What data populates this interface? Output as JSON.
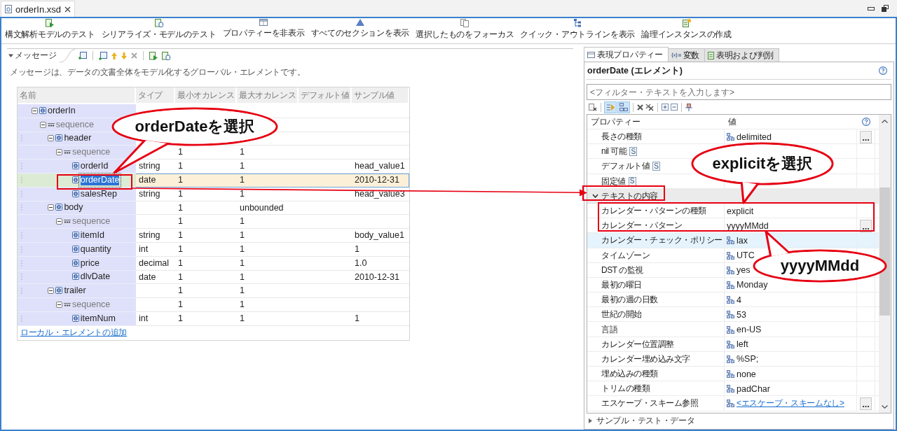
{
  "editor_tab": {
    "title": "orderIn.xsd"
  },
  "toolbar": [
    "構文解析モデルのテスト",
    "シリアライズ・モデルのテスト",
    "プロパティーを非表示",
    "すべてのセクションを表示",
    "選択したものをフォーカス",
    "クイック・アウトラインを表示",
    "論理インスタンスの作成"
  ],
  "message_section": {
    "title": "メッセージ",
    "expanded": true,
    "description": "メッセージは、データの文書全体をモデル化するグローバル・エレメントです。",
    "table": {
      "columns": [
        "名前",
        "タイプ",
        "最小オカレンス",
        "最大オカレンス",
        "デフォルト値",
        "サンプル値"
      ],
      "rows": [
        {
          "kind": "element",
          "name": "orderIn",
          "expanded": true,
          "selected": false,
          "children": [
            {
              "kind": "sequence",
              "name": "sequence",
              "expanded": true,
              "selected": false,
              "children": [
                {
                  "kind": "element",
                  "name": "header",
                  "expanded": true,
                  "grip": true,
                  "selected": false,
                  "children": [
                    {
                      "kind": "sequence",
                      "name": "sequence",
                      "min_occurs": "1",
                      "max_occurs": "1",
                      "expanded": true,
                      "selected": false,
                      "children": [
                        {
                          "kind": "element",
                          "name": "orderId",
                          "type": "string",
                          "min_occurs": "1",
                          "max_occurs": "1",
                          "sample": "head_value1",
                          "grip": true,
                          "selected": false
                        },
                        {
                          "kind": "element",
                          "name": "orderDate",
                          "type": "date",
                          "min_occurs": "1",
                          "max_occurs": "1",
                          "sample": "2010-12-31",
                          "grip": true,
                          "selected": true
                        },
                        {
                          "kind": "element",
                          "name": "salesRep",
                          "type": "string",
                          "min_occurs": "1",
                          "max_occurs": "1",
                          "sample": "head_value3",
                          "grip": true,
                          "selected": false
                        }
                      ]
                    }
                  ]
                },
                {
                  "kind": "element",
                  "name": "body",
                  "min_occurs": "1",
                  "max_occurs": "unbounded",
                  "expanded": true,
                  "grip": true,
                  "selected": false,
                  "children": [
                    {
                      "kind": "sequence",
                      "name": "sequence",
                      "min_occurs": "1",
                      "max_occurs": "1",
                      "expanded": true,
                      "selected": false,
                      "children": [
                        {
                          "kind": "element",
                          "name": "itemId",
                          "type": "string",
                          "min_occurs": "1",
                          "max_occurs": "1",
                          "sample": "body_value1",
                          "grip": true,
                          "selected": false
                        },
                        {
                          "kind": "element",
                          "name": "quantity",
                          "type": "int",
                          "min_occurs": "1",
                          "max_occurs": "1",
                          "sample": "1",
                          "grip": true,
                          "selected": false
                        },
                        {
                          "kind": "element",
                          "name": "price",
                          "type": "decimal",
                          "min_occurs": "1",
                          "max_occurs": "1",
                          "sample": "1.0",
                          "grip": true,
                          "selected": false
                        },
                        {
                          "kind": "element",
                          "name": "dlvDate",
                          "type": "date",
                          "min_occurs": "1",
                          "max_occurs": "1",
                          "sample": "2010-12-31",
                          "grip": true,
                          "selected": false
                        }
                      ]
                    }
                  ]
                },
                {
                  "kind": "element",
                  "name": "trailer",
                  "min_occurs": "1",
                  "max_occurs": "1",
                  "expanded": true,
                  "grip": true,
                  "selected": false,
                  "children": [
                    {
                      "kind": "sequence",
                      "name": "sequence",
                      "min_occurs": "1",
                      "max_occurs": "1",
                      "expanded": true,
                      "selected": false,
                      "children": [
                        {
                          "kind": "element",
                          "name": "itemNum",
                          "type": "int",
                          "min_occurs": "1",
                          "max_occurs": "1",
                          "sample": "1",
                          "grip": true,
                          "selected": false
                        }
                      ]
                    }
                  ]
                }
              ]
            }
          ]
        }
      ],
      "add_link": "ローカル・エレメントの追加"
    }
  },
  "properties_view": {
    "tabs": [
      {
        "label": "表現プロパティー",
        "selected": true
      },
      {
        "label": "変数",
        "selected": false
      },
      {
        "label": "表明および判別",
        "selected": false
      }
    ],
    "title": "orderDate (エレメント)",
    "filter": {
      "placeholder": "<フィルター・テキストを入力します>"
    },
    "toolbar_toggles": [
      {
        "on": true
      },
      {
        "on": true
      }
    ],
    "table": {
      "columns": [
        "プロパティー",
        "値"
      ],
      "rows": [
        {
          "kind": "property",
          "label": "長さの種類",
          "value": "delimited",
          "inherited": true,
          "browse": true,
          "selected": false
        },
        {
          "kind": "property",
          "label": "nil 可能",
          "badge": "S",
          "selected": false
        },
        {
          "kind": "property",
          "label": "デフォルト値",
          "badge": "S",
          "selected": false
        },
        {
          "kind": "property",
          "label": "固定値",
          "badge": "S",
          "selected": false
        },
        {
          "kind": "category",
          "label": "テキストの内容",
          "expanded": true,
          "children": [
            {
              "kind": "property",
              "label": "カレンダー・パターンの種類",
              "value": "explicit",
              "selected": false
            },
            {
              "kind": "property",
              "label": "カレンダー・パターン",
              "value": "yyyyMMdd",
              "browse": true,
              "selected": false
            },
            {
              "kind": "property",
              "label": "カレンダー・チェック・ポリシー",
              "value": "lax",
              "inherited": true,
              "selected": true
            },
            {
              "kind": "property",
              "label": "タイムゾーン",
              "value": "UTC",
              "inherited": true,
              "selected": false
            },
            {
              "kind": "property",
              "label": "DST の監視",
              "value": "yes",
              "inherited": true,
              "selected": false
            },
            {
              "kind": "property",
              "label": "最初の曜日",
              "value": "Monday",
              "inherited": true,
              "selected": false
            },
            {
              "kind": "property",
              "label": "最初の週の日数",
              "value": "4",
              "inherited": true,
              "selected": false
            },
            {
              "kind": "property",
              "label": "世紀の開始",
              "value": "53",
              "inherited": true,
              "selected": false
            },
            {
              "kind": "property",
              "label": "言語",
              "value": "en-US",
              "inherited": true,
              "selected": false
            },
            {
              "kind": "property",
              "label": "カレンダー位置調整",
              "value": "left",
              "inherited": true,
              "selected": false
            },
            {
              "kind": "property",
              "label": "カレンダー埋め込み文字",
              "value": "%SP;",
              "inherited": true,
              "selected": false
            },
            {
              "kind": "property",
              "label": "埋め込みの種類",
              "value": "none",
              "inherited": true,
              "selected": false
            },
            {
              "kind": "property",
              "label": "トリムの種類",
              "value": "padChar",
              "inherited": true,
              "selected": false
            },
            {
              "kind": "property",
              "label": "エスケープ・スキーム参照",
              "value": "<エスケープ・スキームなし>",
              "inherited": true,
              "browse": true,
              "link": true,
              "selected": false
            }
          ]
        }
      ]
    },
    "collapsed_section": {
      "title": "サンプル・テスト・データ",
      "expanded": false
    }
  },
  "annotations": {
    "callouts": [
      {
        "text": "orderDateを選択"
      },
      {
        "text": "explicitを選択"
      },
      {
        "text": "yyyyMMdd"
      }
    ]
  }
}
